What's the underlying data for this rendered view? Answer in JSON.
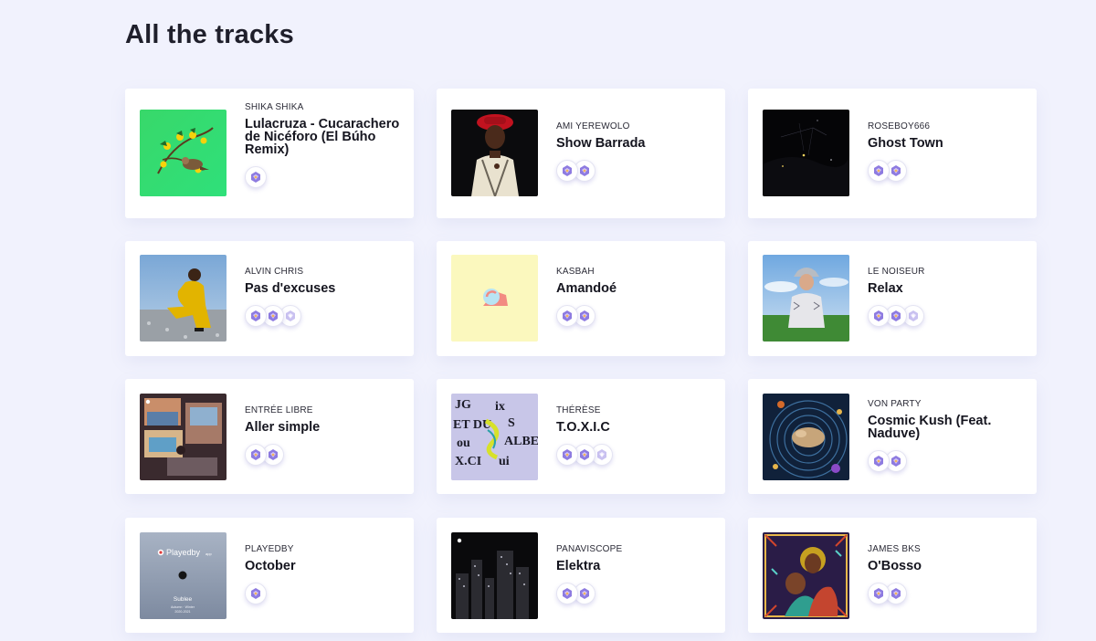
{
  "page": {
    "title": "All the tracks"
  },
  "tracks": [
    {
      "artist": "SHIKA SHIKA",
      "title": "Lulacruza - Cucarachero de Nicéforo (El Búho Remix)",
      "cover": "green-birds-artwork",
      "badges": 1
    },
    {
      "artist": "AMI YEREWOLO",
      "title": "Show Barrada",
      "cover": "woman-red-hat-photo",
      "badges": 2
    },
    {
      "artist": "ROSEBOY666",
      "title": "Ghost Town",
      "cover": "dark-night-photo",
      "badges": 2
    },
    {
      "artist": "ALVIN CHRIS",
      "title": "Pas d'excuses",
      "cover": "man-yellow-jacket-photo",
      "badges": 3
    },
    {
      "artist": "KASBAH",
      "title": "Amandoé",
      "cover": "pastel-shapes-artwork",
      "badges": 2
    },
    {
      "artist": "LE NOISEUR",
      "title": "Relax",
      "cover": "man-bucket-hat-photo",
      "badges": 3
    },
    {
      "artist": "ENTRÉE LIBRE",
      "title": "Aller simple",
      "cover": "collage-artwork",
      "badges": 2
    },
    {
      "artist": "THÉRÈSE",
      "title": "T.O.X.I.C",
      "cover": "text-collage-artwork",
      "badges": 3
    },
    {
      "artist": "VON PARTY",
      "title": "Cosmic Kush (Feat. Naduve)",
      "cover": "cosmic-artwork",
      "badges": 2
    },
    {
      "artist": "PLAYEDBY",
      "title": "October",
      "cover": "playedby-sublee-artwork",
      "badges": 1,
      "cover_text": {
        "brand": "Playedby",
        "brand_suffix": "app",
        "name": "Sublee",
        "line1": "Autumn · Winter",
        "line2": "2020-2021"
      }
    },
    {
      "artist": "PANAVISCOPE",
      "title": "Elektra",
      "cover": "city-night-artwork",
      "badges": 2
    },
    {
      "artist": "JAMES BKS",
      "title": "O'Bosso",
      "cover": "colorful-portrait-artwork",
      "badges": 2
    }
  ],
  "colors": {
    "background": "#f1f2fd",
    "card": "#ffffff",
    "badge_accent": "#8e7be0"
  }
}
